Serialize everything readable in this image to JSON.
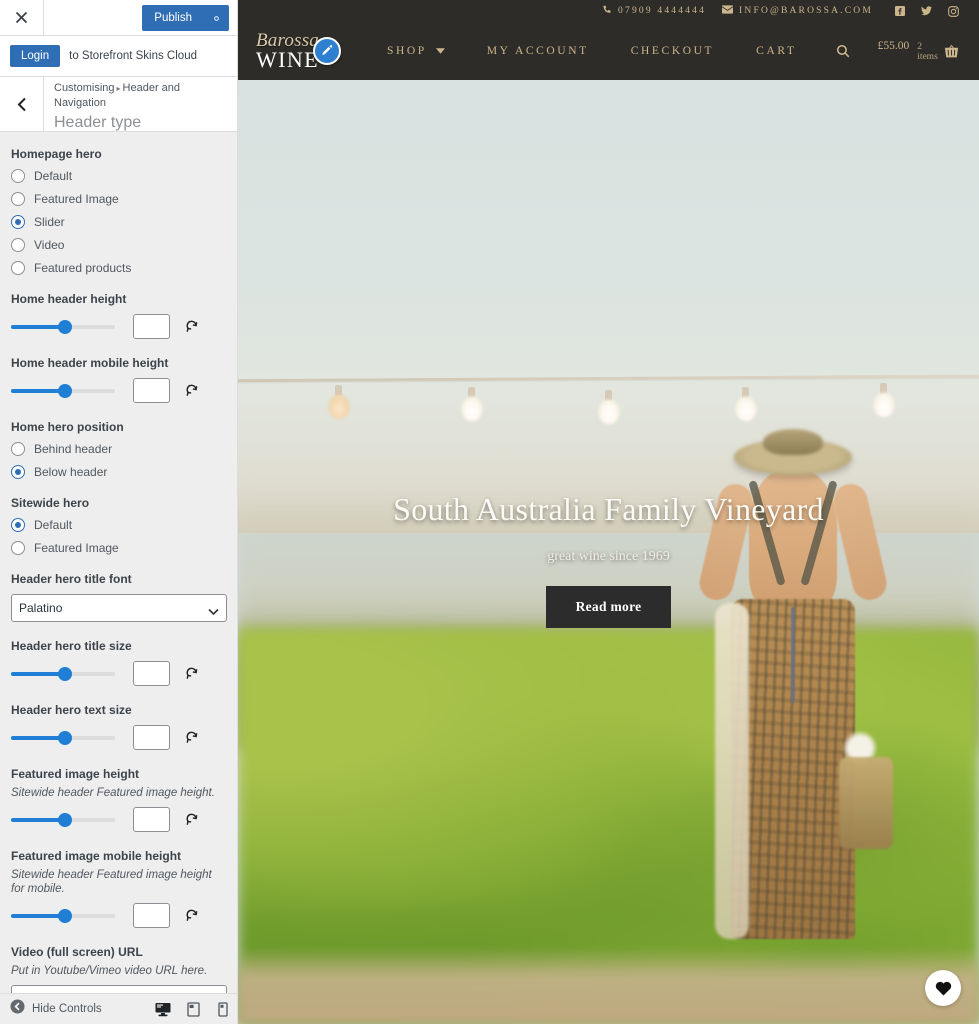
{
  "customizer": {
    "topbar": {
      "close_icon": "close-icon",
      "publish_label": "Publish",
      "gear_icon": "gear-icon"
    },
    "login_bar": {
      "login_label": "Login",
      "text": "to Storefront Skins Cloud"
    },
    "section_header": {
      "back_icon": "chevron-left-icon",
      "breadcrumb_root": "Customising",
      "breadcrumb_sep": "▸",
      "breadcrumb_parent": "Header and Navigation",
      "title": "Header type"
    },
    "controls": [
      {
        "type": "radio-group",
        "label": "Homepage hero",
        "options": [
          "Default",
          "Featured Image",
          "Slider",
          "Video",
          "Featured products"
        ],
        "selected": "Slider"
      },
      {
        "type": "slider",
        "label": "Home header height",
        "value": "",
        "percent": 52,
        "reset_icon": "reset-icon"
      },
      {
        "type": "slider",
        "label": "Home header mobile height",
        "value": "",
        "percent": 52,
        "reset_icon": "reset-icon"
      },
      {
        "type": "radio-group",
        "label": "Home hero position",
        "options": [
          "Behind header",
          "Below header"
        ],
        "selected": "Below header"
      },
      {
        "type": "radio-group",
        "label": "Sitewide hero",
        "options": [
          "Default",
          "Featured Image"
        ],
        "selected": "Default"
      },
      {
        "type": "select",
        "label": "Header hero title font",
        "value": "Palatino",
        "chevron_icon": "chevron-down-icon"
      },
      {
        "type": "slider",
        "label": "Header hero title size",
        "value": "",
        "percent": 52,
        "reset_icon": "reset-icon"
      },
      {
        "type": "slider",
        "label": "Header hero text size",
        "value": "",
        "percent": 52,
        "reset_icon": "reset-icon"
      },
      {
        "type": "slider",
        "label": "Featured image height",
        "description": "Sitewide header Featured image height.",
        "value": "",
        "percent": 52,
        "reset_icon": "reset-icon"
      },
      {
        "type": "slider",
        "label": "Featured image mobile height",
        "description": "Sitewide header Featured image height for mobile.",
        "value": "",
        "percent": 52,
        "reset_icon": "reset-icon"
      },
      {
        "type": "text",
        "label": "Video (full screen) URL",
        "description": "Put in Youtube/Vimeo video URL here.",
        "value": "",
        "placeholder": ""
      }
    ],
    "footer": {
      "hide_controls_label": "Hide Controls",
      "hide_icon": "collapse-icon",
      "devices": [
        {
          "name": "desktop-preview",
          "icon": "desktop-icon",
          "active": true
        },
        {
          "name": "tablet-preview",
          "icon": "tablet-icon",
          "active": false
        },
        {
          "name": "mobile-preview",
          "icon": "mobile-icon",
          "active": false
        }
      ]
    },
    "colors": {
      "accent_blue": "#2f6eb5",
      "slider_blue": "#1e7fd4",
      "panel_bg": "#eeeeee"
    }
  },
  "site": {
    "topbar": {
      "phone_icon": "phone-icon",
      "phone": "07909 4444444",
      "email_icon": "envelope-icon",
      "email": "INFO@BAROSSA.COM",
      "social": [
        {
          "name": "facebook-icon"
        },
        {
          "name": "twitter-icon"
        },
        {
          "name": "instagram-icon"
        }
      ]
    },
    "nav": {
      "logo_top": "Barossa",
      "logo_bottom": "WINE",
      "edit_badge_icon": "pencil-edit-icon",
      "links": [
        {
          "label": "SHOP",
          "has_dropdown": true
        },
        {
          "label": "MY ACCOUNT",
          "has_dropdown": false
        },
        {
          "label": "CHECKOUT",
          "has_dropdown": false
        },
        {
          "label": "CART",
          "has_dropdown": false
        }
      ],
      "search_icon": "search-icon",
      "cart_amount": "£55.00",
      "cart_count": "2 items",
      "basket_icon": "basket-icon"
    },
    "hero": {
      "title": "South Australia Family Vineyard",
      "subtitle": "great wine since 1969",
      "button_label": "Read more",
      "favorite_icon": "heart-icon"
    },
    "colors": {
      "nav_bg": "#2e2c29",
      "gold_text": "#cbb68b",
      "hero_btn_bg": "#2c2c2c"
    }
  }
}
